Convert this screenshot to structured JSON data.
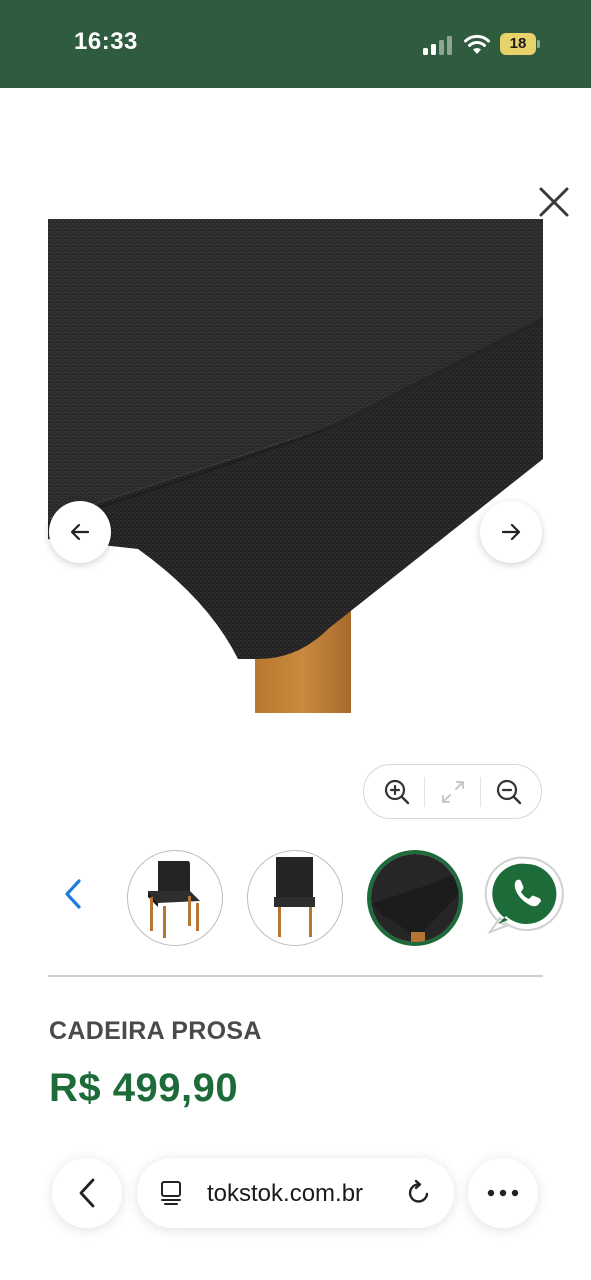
{
  "status_bar": {
    "time": "16:33",
    "battery_level": "18",
    "background_color": "#2f5b3f"
  },
  "icons": {
    "close": "close-icon",
    "previous": "arrow-left-icon",
    "next": "arrow-right-icon",
    "zoom_in": "zoom-in-icon",
    "fit": "expand-icon",
    "zoom_out": "zoom-out-icon",
    "thumbnails_previous": "chevron-left-icon",
    "whatsapp": "whatsapp-icon",
    "browser_back": "chevron-left-icon",
    "page": "page-icon",
    "reload": "reload-icon",
    "more": "more-icon"
  },
  "gallery": {
    "thumbnails": [
      {
        "name": "chair-front-view"
      },
      {
        "name": "chair-side-view"
      },
      {
        "name": "seat-fabric-detail",
        "selected": true
      }
    ]
  },
  "product": {
    "name": "CADEIRA PROSA",
    "price": "R$ 499,90",
    "price_color": "#1e6b3a"
  },
  "browser": {
    "url": "tokstok.com.br"
  }
}
